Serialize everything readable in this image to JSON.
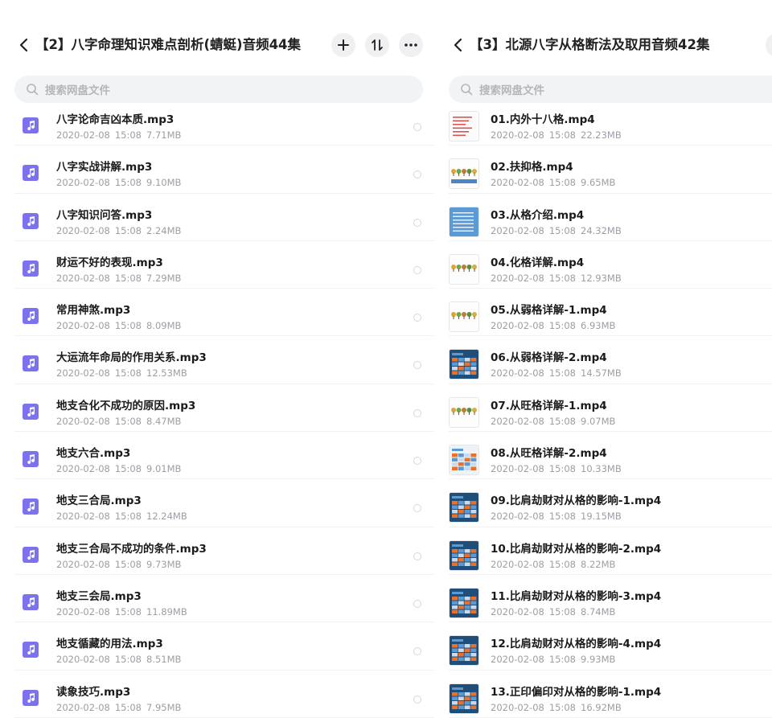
{
  "left": {
    "title": "【2】八字命理知识难点剖析(蜻蜓)音频44集",
    "search_placeholder": "搜索网盘文件",
    "files": [
      {
        "name": "八字论命吉凶本质.mp3",
        "date": "2020-02-08",
        "time": "15:08",
        "size": "7.71MB"
      },
      {
        "name": "八字实战讲解.mp3",
        "date": "2020-02-08",
        "time": "15:08",
        "size": "9.10MB"
      },
      {
        "name": "八字知识问答.mp3",
        "date": "2020-02-08",
        "time": "15:08",
        "size": "2.24MB"
      },
      {
        "name": "财运不好的表现.mp3",
        "date": "2020-02-08",
        "time": "15:08",
        "size": "7.29MB"
      },
      {
        "name": "常用神煞.mp3",
        "date": "2020-02-08",
        "time": "15:08",
        "size": "8.09MB"
      },
      {
        "name": "大运流年命局的作用关系.mp3",
        "date": "2020-02-08",
        "time": "15:08",
        "size": "12.53MB"
      },
      {
        "name": "地支合化不成功的原因.mp3",
        "date": "2020-02-08",
        "time": "15:08",
        "size": "8.47MB"
      },
      {
        "name": "地支六合.mp3",
        "date": "2020-02-08",
        "time": "15:08",
        "size": "9.01MB"
      },
      {
        "name": "地支三合局.mp3",
        "date": "2020-02-08",
        "time": "15:08",
        "size": "12.24MB"
      },
      {
        "name": "地支三合局不成功的条件.mp3",
        "date": "2020-02-08",
        "time": "15:08",
        "size": "9.73MB"
      },
      {
        "name": "地支三会局.mp3",
        "date": "2020-02-08",
        "time": "15:08",
        "size": "11.89MB"
      },
      {
        "name": "地支循藏的用法.mp3",
        "date": "2020-02-08",
        "time": "15:08",
        "size": "8.51MB"
      },
      {
        "name": "读象技巧.mp3",
        "date": "2020-02-08",
        "time": "15:08",
        "size": "7.95MB"
      }
    ]
  },
  "right": {
    "title": "【3】北源八字从格断法及取用音频42集",
    "search_placeholder": "搜索网盘文件",
    "files": [
      {
        "name": "01.内外十八格.mp4",
        "date": "2020-02-08",
        "time": "15:08",
        "size": "22.23MB",
        "thumb": "text"
      },
      {
        "name": "02.扶抑格.mp4",
        "date": "2020-02-08",
        "time": "15:08",
        "size": "9.65MB",
        "thumb": "trees-blue"
      },
      {
        "name": "03.从格介绍.mp4",
        "date": "2020-02-08",
        "time": "15:08",
        "size": "24.32MB",
        "thumb": "blue"
      },
      {
        "name": "04.化格详解.mp4",
        "date": "2020-02-08",
        "time": "15:08",
        "size": "12.93MB",
        "thumb": "trees"
      },
      {
        "name": "05.从弱格详解-1.mp4",
        "date": "2020-02-08",
        "time": "15:08",
        "size": "6.93MB",
        "thumb": "trees"
      },
      {
        "name": "06.从弱格详解-2.mp4",
        "date": "2020-02-08",
        "time": "15:08",
        "size": "14.57MB",
        "thumb": "table"
      },
      {
        "name": "07.从旺格详解-1.mp4",
        "date": "2020-02-08",
        "time": "15:08",
        "size": "9.07MB",
        "thumb": "trees"
      },
      {
        "name": "08.从旺格详解-2.mp4",
        "date": "2020-02-08",
        "time": "15:08",
        "size": "10.33MB",
        "thumb": "table-light"
      },
      {
        "name": "09.比肩劫财对从格的影响-1.mp4",
        "date": "2020-02-08",
        "time": "15:08",
        "size": "19.15MB",
        "thumb": "table"
      },
      {
        "name": "10.比肩劫财对从格的影响-2.mp4",
        "date": "2020-02-08",
        "time": "15:08",
        "size": "8.22MB",
        "thumb": "table"
      },
      {
        "name": "11.比肩劫财对从格的影响-3.mp4",
        "date": "2020-02-08",
        "time": "15:08",
        "size": "8.74MB",
        "thumb": "table"
      },
      {
        "name": "12.比肩劫财对从格的影响-4.mp4",
        "date": "2020-02-08",
        "time": "15:08",
        "size": "9.93MB",
        "thumb": "table"
      },
      {
        "name": "13.正印偏印对从格的影响-1.mp4",
        "date": "2020-02-08",
        "time": "15:08",
        "size": "16.92MB",
        "thumb": "table"
      }
    ]
  },
  "icons": {
    "back": "chevron-left-icon",
    "add": "plus-icon",
    "sort": "sort-icon",
    "more": "more-dots-icon",
    "search": "search-icon",
    "audio": "music-note-icon"
  },
  "colors": {
    "audio_icon_bg": "#7d72ee",
    "title_text": "#222222",
    "meta_text": "#9b9ea4",
    "search_bg": "#f2f3f5"
  }
}
